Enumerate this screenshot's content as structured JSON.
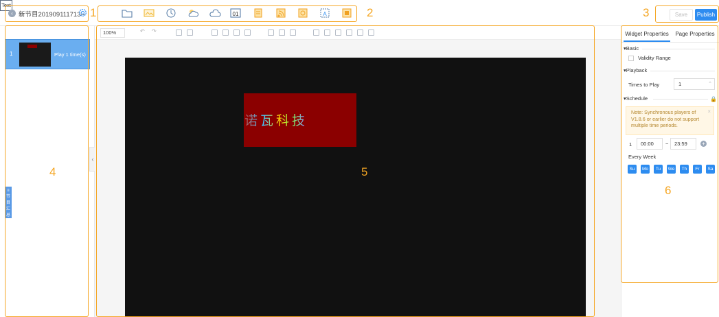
{
  "header": {
    "program_title": "新节目201909111713--",
    "save_label": "Save",
    "publish_label": "Publish",
    "tools": [
      "text-tool",
      "folder-tool",
      "image-tool",
      "clock-tool",
      "weather-tool",
      "cloud-tool",
      "counter-tool",
      "document-tool",
      "rss-tool",
      "web-tool",
      "media-tool",
      "stop-tool"
    ],
    "text_tool_label": "Text",
    "counter_label": "01"
  },
  "annotations": [
    "1",
    "2",
    "3",
    "4",
    "5",
    "6"
  ],
  "left_panel": {
    "tools": [
      "+",
      "⧉",
      "🗑",
      "↑",
      "↓"
    ],
    "pages": [
      {
        "index": "1",
        "label": "Play 1 time(s)"
      }
    ],
    "side_tab_label": "≡节目汇总"
  },
  "center": {
    "zoom": "100%",
    "widget_text": "诺瓦科技",
    "canvas_color": "#111111",
    "widget_color": "#8b0000"
  },
  "right_panel": {
    "tabs": [
      "Widget Properties",
      "Page Properties"
    ],
    "active_tab": "Widget Properties",
    "sections": {
      "basic": "Basic",
      "playback": "Playback",
      "schedule": "Schedule"
    },
    "validity_label": "Validity Range",
    "times_label": "Times to Play",
    "times_value": "1",
    "note": "Note: Synchronous players of V1.8.6 or earlier do not support multiple time periods.",
    "period_index": "1",
    "start_time": "00:00",
    "end_time": "23:59",
    "time_sep": "~",
    "every_week_label": "Every Week",
    "days": [
      "Su",
      "Mo",
      "Tu",
      "We",
      "Th",
      "Fr",
      "Sa"
    ]
  },
  "colors": {
    "accent": "#2d8cf0",
    "annotation": "#f5a623"
  }
}
